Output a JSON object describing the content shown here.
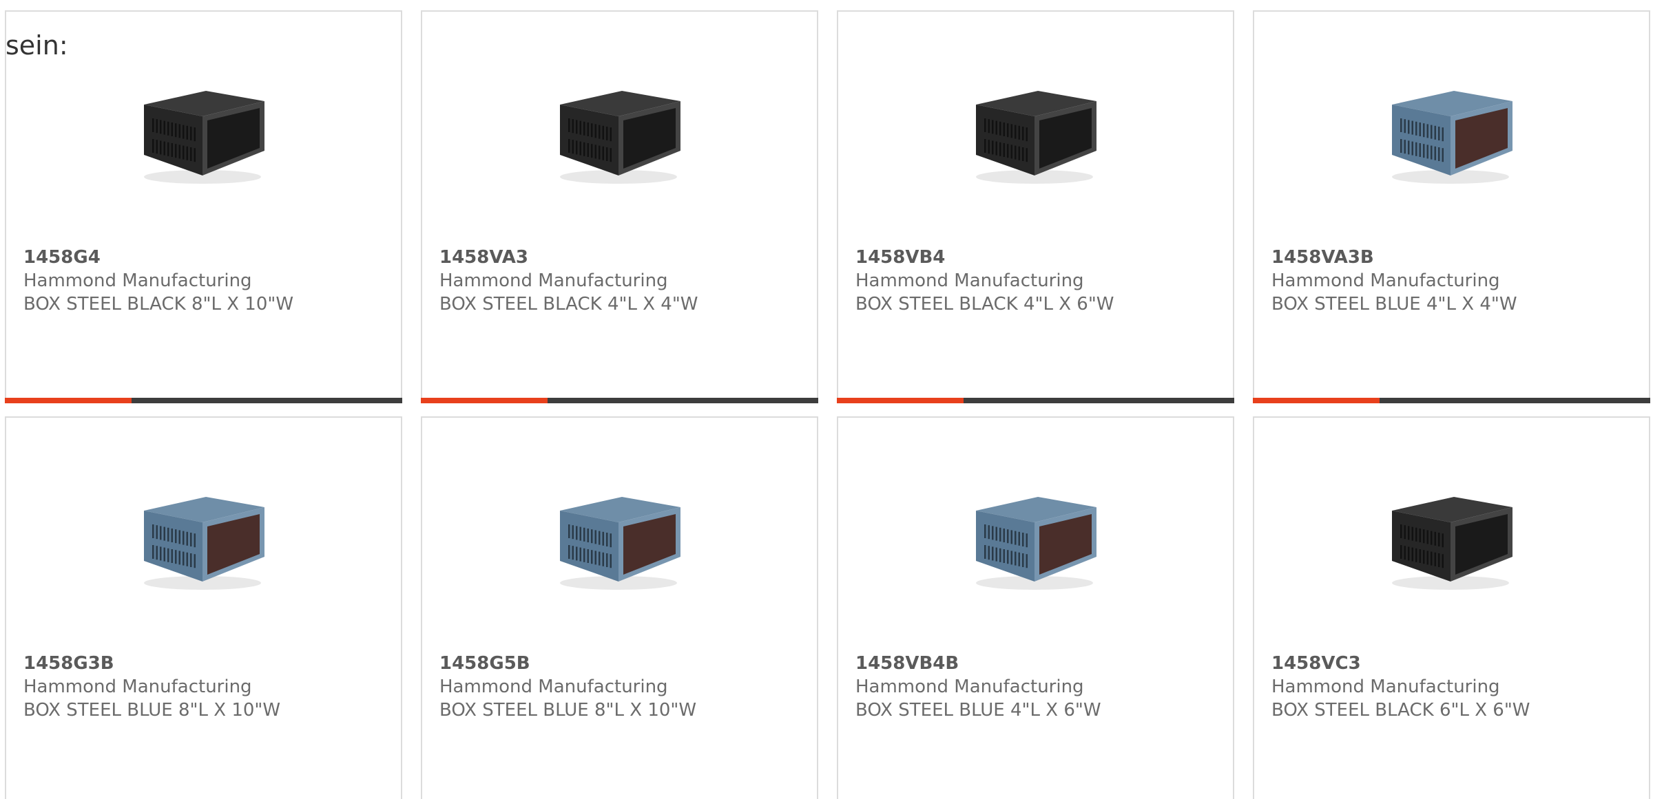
{
  "intro_text": "sein:",
  "accent_color": "#e8401c",
  "bar_color": "#3d3d3d",
  "products": [
    {
      "part_number": "1458G4",
      "manufacturer": "Hammond Manufacturing",
      "description": "BOX STEEL BLACK 8\"L X 10\"W",
      "color": "black"
    },
    {
      "part_number": "1458VA3",
      "manufacturer": "Hammond Manufacturing",
      "description": "BOX STEEL BLACK 4\"L X 4\"W",
      "color": "black"
    },
    {
      "part_number": "1458VB4",
      "manufacturer": "Hammond Manufacturing",
      "description": "BOX STEEL BLACK 4\"L X 6\"W",
      "color": "black"
    },
    {
      "part_number": "1458VA3B",
      "manufacturer": "Hammond Manufacturing",
      "description": "BOX STEEL BLUE 4\"L X 4\"W",
      "color": "blue"
    },
    {
      "part_number": "1458G3B",
      "manufacturer": "Hammond Manufacturing",
      "description": "BOX STEEL BLUE 8\"L X 10\"W",
      "color": "blue"
    },
    {
      "part_number": "1458G5B",
      "manufacturer": "Hammond Manufacturing",
      "description": "BOX STEEL BLUE 8\"L X 10\"W",
      "color": "blue"
    },
    {
      "part_number": "1458VB4B",
      "manufacturer": "Hammond Manufacturing",
      "description": "BOX STEEL BLUE 4\"L X 6\"W",
      "color": "blue"
    },
    {
      "part_number": "1458VC3",
      "manufacturer": "Hammond Manufacturing",
      "description": "BOX STEEL BLACK 6\"L X 6\"W",
      "color": "black"
    }
  ]
}
